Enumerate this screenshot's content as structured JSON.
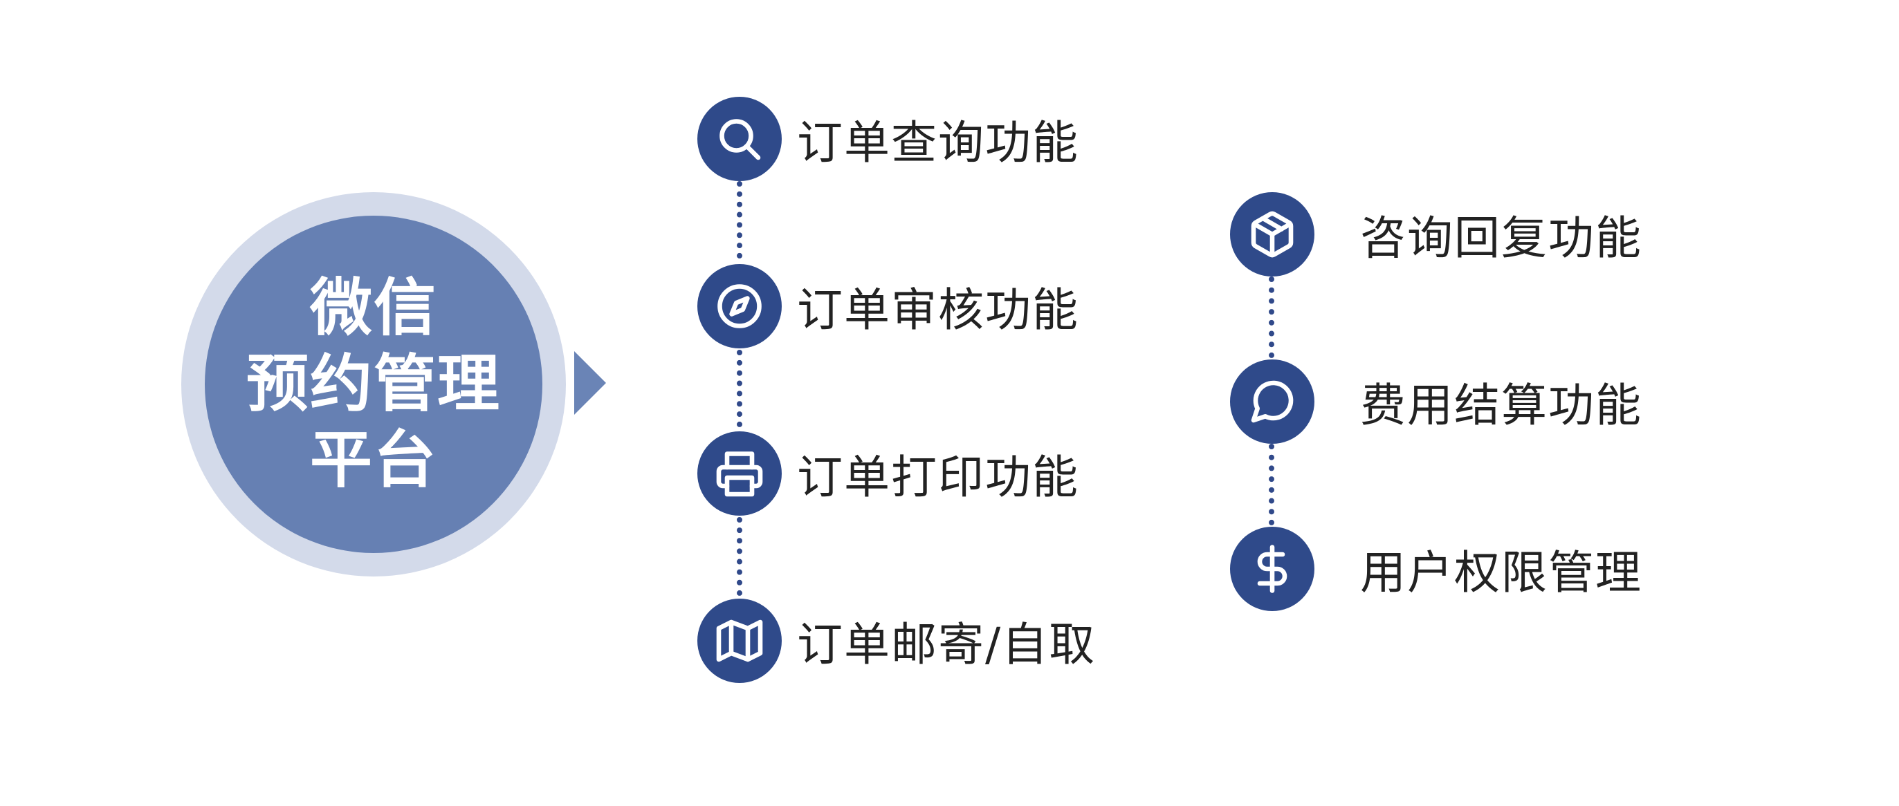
{
  "hub": {
    "lines": [
      "微信",
      "预约管理",
      "平台"
    ],
    "color_outer": "#d3daea",
    "color_inner": "#6680b3"
  },
  "accent_color": "#2f4a8a",
  "left_items": [
    {
      "label": "订单查询功能",
      "icon": "search-icon"
    },
    {
      "label": "订单审核功能",
      "icon": "compass-icon"
    },
    {
      "label": "订单打印功能",
      "icon": "printer-icon"
    },
    {
      "label": "订单邮寄/自取",
      "icon": "map-icon"
    }
  ],
  "right_items": [
    {
      "label": "咨询回复功能",
      "icon": "package-icon"
    },
    {
      "label": "费用结算功能",
      "icon": "chat-bubble-icon"
    },
    {
      "label": "用户权限管理",
      "icon": "dollar-icon"
    }
  ]
}
